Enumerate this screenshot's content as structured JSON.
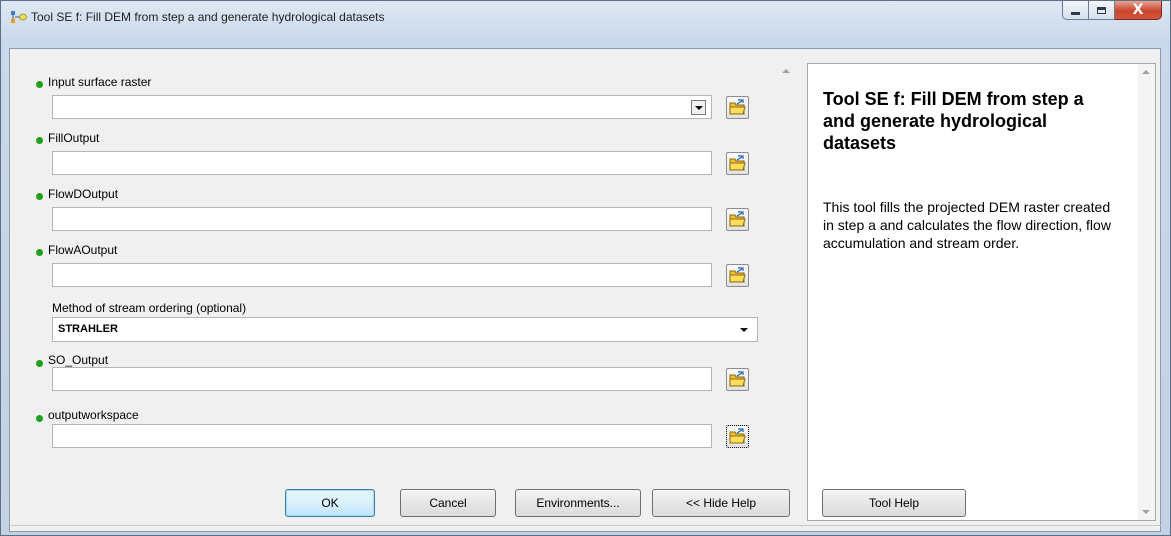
{
  "window": {
    "title": "Tool SE f: Fill DEM from step a and generate hydrological datasets",
    "controls": {
      "minimize": "minimize",
      "maximize": "maximize",
      "close": "X"
    }
  },
  "params": [
    {
      "label": "Input surface raster",
      "required": true,
      "type": "combo",
      "value": ""
    },
    {
      "label": "FillOutput",
      "required": true,
      "type": "text",
      "value": ""
    },
    {
      "label": "FlowDOutput",
      "required": true,
      "type": "text",
      "value": ""
    },
    {
      "label": "FlowAOutput",
      "required": true,
      "type": "text",
      "value": ""
    },
    {
      "label": "Method of stream ordering (optional)",
      "required": false,
      "type": "select",
      "value": "STRAHLER"
    },
    {
      "label": "SO_Output",
      "required": true,
      "type": "text",
      "value": ""
    },
    {
      "label": "outputworkspace",
      "required": true,
      "type": "text",
      "value": ""
    }
  ],
  "help": {
    "title": "Tool SE f: Fill DEM from step a and generate hydrological datasets",
    "body": "This tool fills the projected DEM raster created in step a and calculates the flow direction, flow accumulation and stream order."
  },
  "buttons": {
    "ok": "OK",
    "cancel": "Cancel",
    "environments": "Environments...",
    "hide_help": "<< Hide Help",
    "tool_help": "Tool Help"
  },
  "icons": {
    "title": "model-tool-icon",
    "browse": "folder-browse-icon",
    "required": "required-dot-icon"
  },
  "colors": {
    "required_dot": "#1ea01e",
    "default_button": "#bee6fd",
    "close_button": "#c9452c"
  }
}
